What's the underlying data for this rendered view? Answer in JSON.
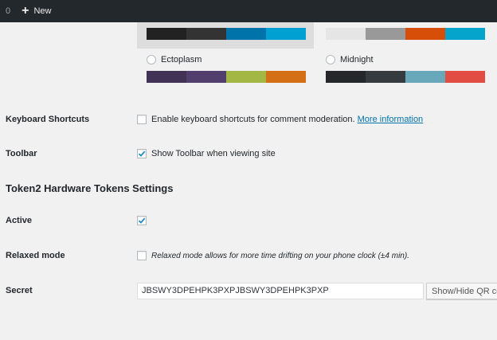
{
  "adminbar": {
    "count": "0",
    "new_label": "New"
  },
  "color_schemes": {
    "top_left": {
      "colors": [
        "#222222",
        "#333333",
        "#0073aa",
        "#00a0d2"
      ],
      "selected": true
    },
    "top_right": {
      "colors": [
        "#e5e5e5",
        "#999999",
        "#d64e07",
        "#04a4cc"
      ],
      "selected": false
    },
    "ectoplasm": {
      "label": "Ectoplasm",
      "colors": [
        "#413256",
        "#523f6d",
        "#a3b745",
        "#d46f15"
      ],
      "selected": false
    },
    "midnight": {
      "label": "Midnight",
      "colors": [
        "#25282b",
        "#363b3f",
        "#69a8bb",
        "#e14d43"
      ],
      "selected": false
    }
  },
  "keyboard_shortcuts": {
    "label": "Keyboard Shortcuts",
    "description": "Enable keyboard shortcuts for comment moderation.",
    "link": "More information",
    "checked": false
  },
  "toolbar": {
    "label": "Toolbar",
    "description": "Show Toolbar when viewing site",
    "checked": true
  },
  "token2": {
    "section_title": "Token2 Hardware Tokens Settings",
    "active": {
      "label": "Active",
      "checked": true
    },
    "relaxed_mode": {
      "label": "Relaxed mode",
      "description": "Relaxed mode allows for more time drifting on your phone clock (±4 min).",
      "checked": false
    },
    "secret": {
      "label": "Secret",
      "value": "JBSWY3DPEHPK3PXPJBSWY3DPEHPK3PXP",
      "button_label": "Show/Hide QR code"
    }
  },
  "accent_colors": {
    "link": "#0073aa",
    "checkmark": "#1e8cbe",
    "adminbar": "#23282d"
  }
}
